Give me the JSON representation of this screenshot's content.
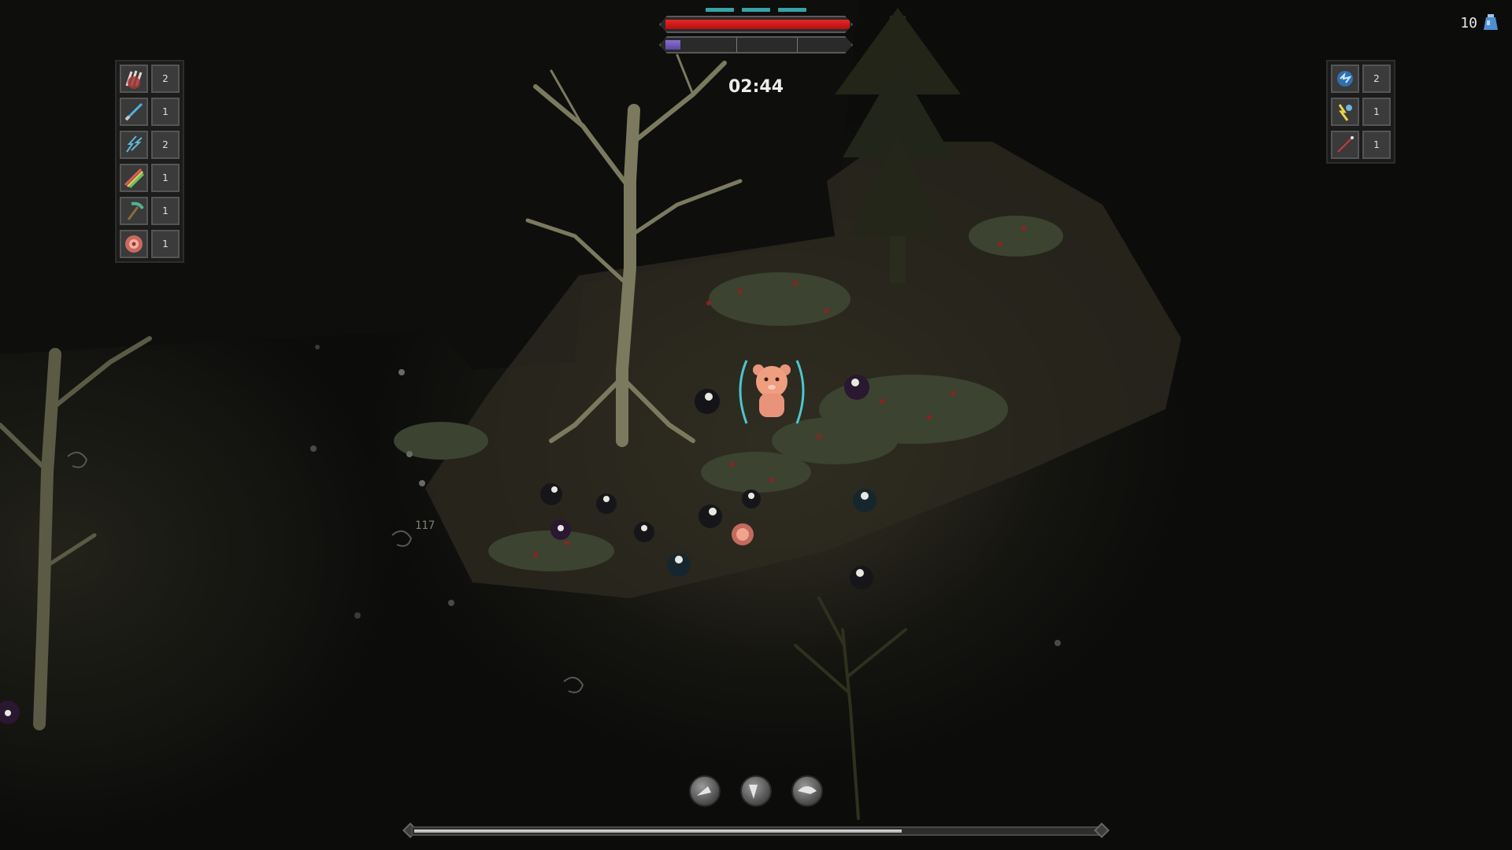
{
  "hud": {
    "timer": "02:44",
    "health_fraction": 1.0,
    "experience_fraction": 0.08,
    "shield_pips": 3,
    "gem_count": "10",
    "stage_progress_fraction": 0.71
  },
  "left_skills": [
    {
      "icon": "claw-icon",
      "level": "2"
    },
    {
      "icon": "sword-icon",
      "level": "1"
    },
    {
      "icon": "lightning-icon",
      "level": "2"
    },
    {
      "icon": "rainbow-icon",
      "level": "1"
    },
    {
      "icon": "pickaxe-icon",
      "level": "1"
    },
    {
      "icon": "vortex-icon",
      "level": "1"
    }
  ],
  "right_skills": [
    {
      "icon": "energy-orb-icon",
      "level": "2"
    },
    {
      "icon": "yellow-lightning-icon",
      "level": "1"
    },
    {
      "icon": "needle-icon",
      "level": "1"
    }
  ],
  "abilities": [
    {
      "icon": "dash-icon"
    },
    {
      "icon": "shield-icon"
    },
    {
      "icon": "slash-icon"
    }
  ],
  "world": {
    "damage_number": "117"
  },
  "colors": {
    "health": "#d61c1c",
    "experience": "#7a63c4",
    "shield": "#38a3a5",
    "gem": "#4e8ed1"
  }
}
